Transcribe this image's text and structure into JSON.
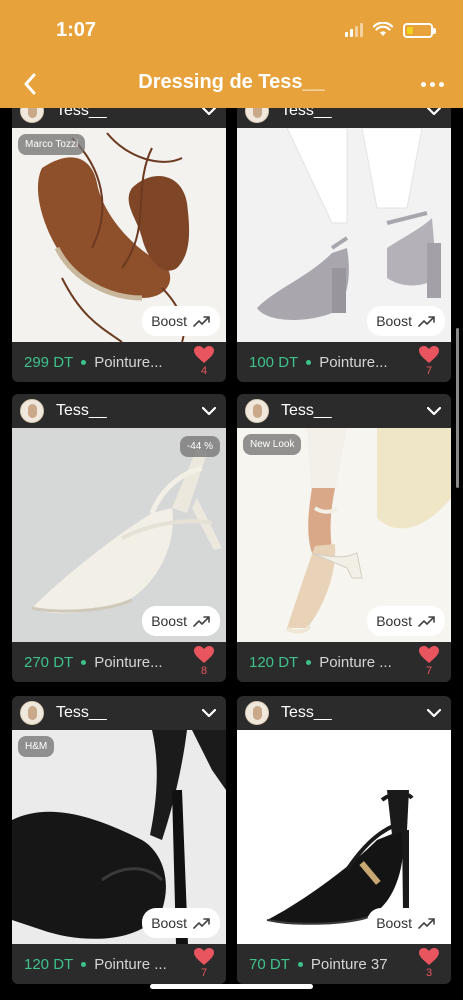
{
  "status": {
    "time": "1:07",
    "battery_level": 0.25,
    "colors": {
      "bar": "#e8a23c",
      "battery": "#f2d21d"
    }
  },
  "nav": {
    "title": "Dressing de Tess__",
    "back_icon": "chevron-left-icon",
    "more_icon": "more-horizontal-icon"
  },
  "colors": {
    "price": "#3ec28c",
    "like": "#e8555e",
    "card": "#2b2b2b"
  },
  "products": [
    {
      "seller": "Tess__",
      "brand": "Marco Tozzi",
      "discount": "",
      "boost": "Boost",
      "price": "299 DT",
      "size": "Pointure...",
      "likes": "4"
    },
    {
      "seller": "Tess__",
      "brand": "",
      "discount": "",
      "boost": "Boost",
      "price": "100 DT",
      "size": "Pointure...",
      "likes": "7"
    },
    {
      "seller": "Tess__",
      "brand": "",
      "discount": "-44 %",
      "boost": "Boost",
      "price": "270 DT",
      "size": "Pointure...",
      "likes": "8"
    },
    {
      "seller": "Tess__",
      "brand": "New Look",
      "discount": "",
      "boost": "Boost",
      "price": "120 DT",
      "size": "Pointure ...",
      "likes": "7"
    },
    {
      "seller": "Tess__",
      "brand": "H&M",
      "discount": "",
      "boost": "Boost",
      "price": "120 DT",
      "size": "Pointure ...",
      "likes": "7"
    },
    {
      "seller": "Tess__",
      "brand": "",
      "discount": "",
      "boost": "Boost",
      "price": "70 DT",
      "size": "Pointure 37",
      "likes": "3"
    }
  ]
}
